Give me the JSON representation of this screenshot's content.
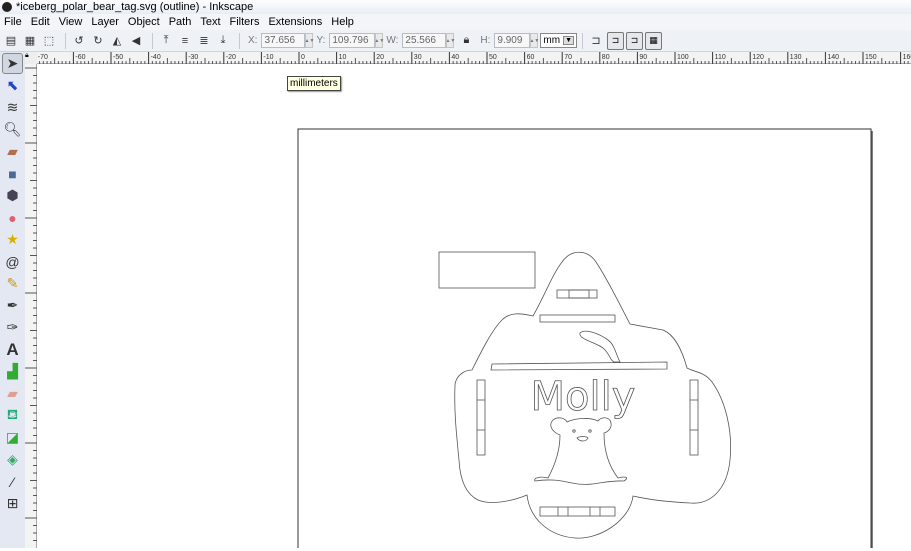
{
  "window": {
    "title": "*iceberg_polar_bear_tag.svg (outline) - Inkscape"
  },
  "menu": [
    "File",
    "Edit",
    "View",
    "Layer",
    "Object",
    "Path",
    "Text",
    "Filters",
    "Extensions",
    "Help"
  ],
  "toolbar": {
    "x_label": "X:",
    "x_value": "37.656",
    "y_label": "Y:",
    "y_value": "109.796",
    "w_label": "W:",
    "w_value": "25.566",
    "h_label": "H:",
    "h_value": "9.909",
    "unit": "mm"
  },
  "ruler": {
    "labels": [
      "-70",
      "-60",
      "-50",
      "-40",
      "-30",
      "-20",
      "-10",
      "0",
      "10",
      "20",
      "30",
      "40",
      "50",
      "60",
      "70",
      "80",
      "90",
      "100",
      "110",
      "120",
      "130",
      "140",
      "150",
      "160"
    ]
  },
  "tooltip": "millimeters",
  "canvas": {
    "text": "Molly"
  },
  "tools": [
    "select",
    "node",
    "tweak",
    "zoom",
    "measure",
    "rectangle",
    "3d-box",
    "ellipse",
    "star",
    "spiral",
    "pencil",
    "pen",
    "calligraphy",
    "text",
    "spray",
    "eraser",
    "paint-bucket",
    "gradient",
    "mesh",
    "dropper",
    "connector"
  ]
}
